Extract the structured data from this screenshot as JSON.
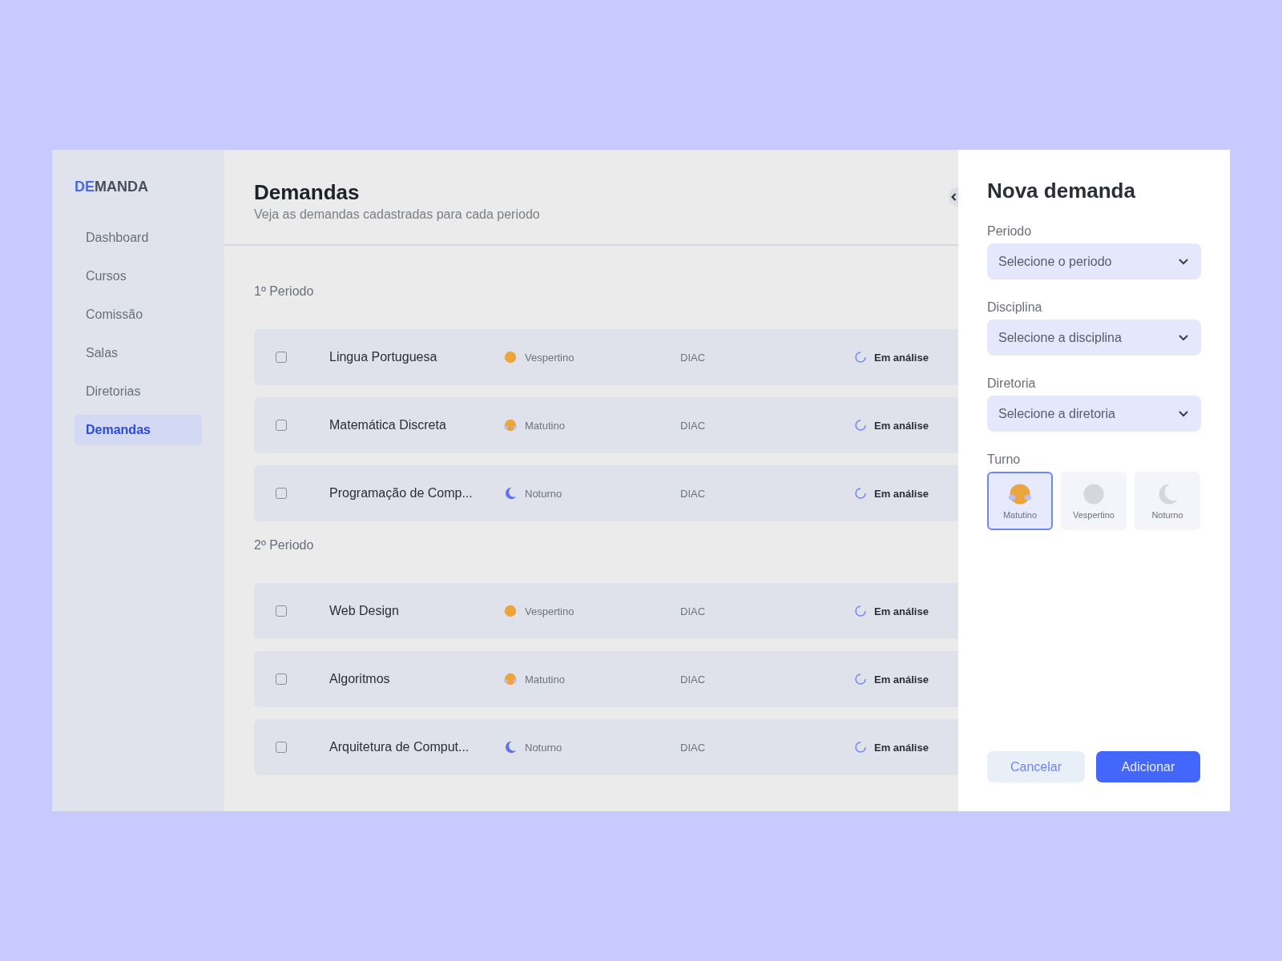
{
  "sidebar": {
    "logo": {
      "accent": "DE",
      "rest": "MANDA"
    },
    "items": [
      {
        "label": "Dashboard",
        "selected": false
      },
      {
        "label": "Cursos",
        "selected": false
      },
      {
        "label": "Comissão",
        "selected": false
      },
      {
        "label": "Salas",
        "selected": false
      },
      {
        "label": "Diretorias",
        "selected": false
      },
      {
        "label": "Demandas",
        "selected": true
      }
    ]
  },
  "main": {
    "title": "Demandas",
    "subtitle": "Veja as demandas cadastradas para cada periodo",
    "sections": [
      {
        "title": "1º Periodo",
        "rows": [
          {
            "checked": false,
            "name": "Lingua Portuguesa",
            "shift": {
              "kind": "vespertino",
              "label": "Vespertino"
            },
            "unit": "DIAC",
            "status": "Em análise"
          },
          {
            "checked": false,
            "name": "Matemática Discreta",
            "shift": {
              "kind": "matutino",
              "label": "Matutino"
            },
            "unit": "DIAC",
            "status": "Em análise"
          },
          {
            "checked": false,
            "name": "Programação de Comp...",
            "shift": {
              "kind": "noturno",
              "label": "Noturno"
            },
            "unit": "DIAC",
            "status": "Em análise"
          }
        ]
      },
      {
        "title": "2º Periodo",
        "rows": [
          {
            "checked": false,
            "name": "Web Design",
            "shift": {
              "kind": "vespertino",
              "label": "Vespertino"
            },
            "unit": "DIAC",
            "status": "Em análise"
          },
          {
            "checked": false,
            "name": "Algoritmos",
            "shift": {
              "kind": "matutino",
              "label": "Matutino"
            },
            "unit": "DIAC",
            "status": "Em análise"
          },
          {
            "checked": false,
            "name": "Arquitetura de Comput...",
            "shift": {
              "kind": "noturno",
              "label": "Noturno"
            },
            "unit": "DIAC",
            "status": "Em análise"
          }
        ]
      }
    ]
  },
  "panel": {
    "title": "Nova demanda",
    "fields": [
      {
        "label": "Periodo",
        "placeholder": "Selecione o periodo"
      },
      {
        "label": "Disciplina",
        "placeholder": "Selecione a disciplina"
      },
      {
        "label": "Diretoria",
        "placeholder": "Selecione a diretoria"
      }
    ],
    "turno": {
      "label": "Turno",
      "options": [
        {
          "kind": "matutino",
          "label": "Matutino",
          "selected": true
        },
        {
          "kind": "vespertino",
          "label": "Vespertino",
          "selected": false
        },
        {
          "kind": "noturno",
          "label": "Noturno",
          "selected": false
        }
      ]
    },
    "buttons": {
      "cancel": "Cancelar",
      "submit": "Adicionar"
    }
  }
}
